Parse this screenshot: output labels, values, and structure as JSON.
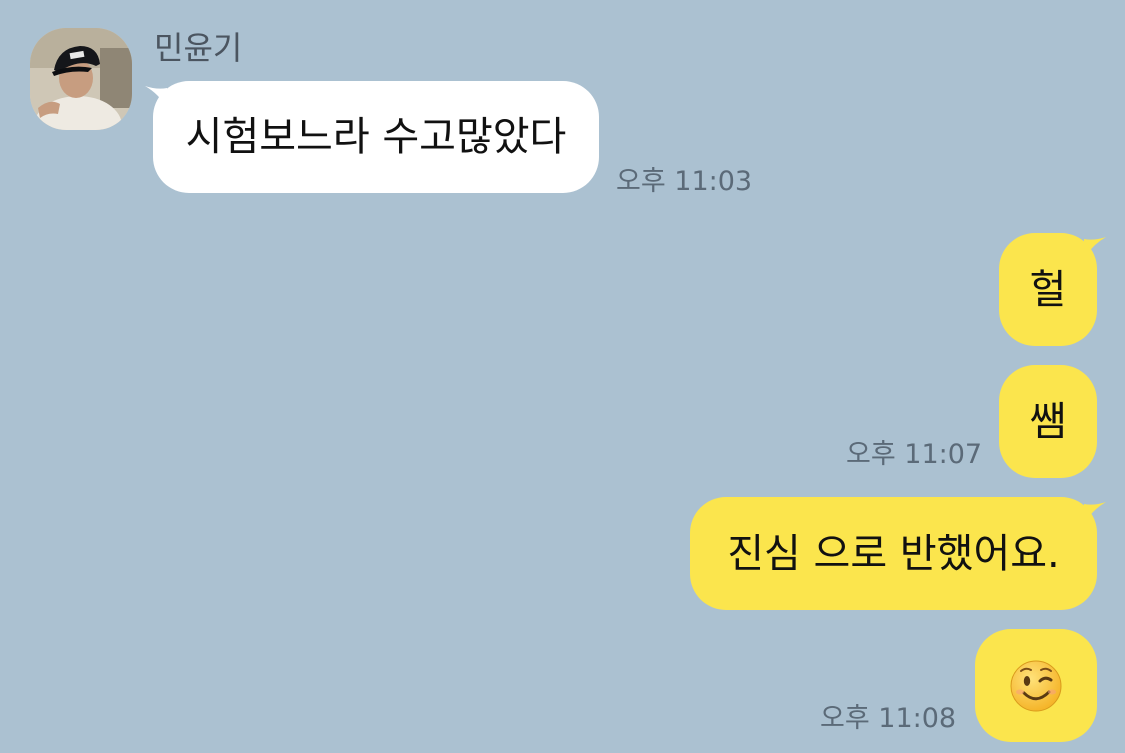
{
  "chat": {
    "background_color": "#abc1d1",
    "outgoing_bubble_color": "#fbe54d",
    "incoming_bubble_color": "#ffffff",
    "sender": {
      "name": "민윤기",
      "avatar_icon": "profile-photo-icon"
    },
    "messages": [
      {
        "direction": "incoming",
        "text": "시험보느라 수고많았다",
        "time": "오후 11:03"
      },
      {
        "direction": "outgoing",
        "text": "헐",
        "time": ""
      },
      {
        "direction": "outgoing",
        "text": "쌤",
        "time": "오후 11:07"
      },
      {
        "direction": "outgoing",
        "text": "진심 으로 반했어요.",
        "time": ""
      },
      {
        "direction": "outgoing",
        "emoji": "winking-face-icon",
        "time": "오후 11:08"
      }
    ]
  }
}
